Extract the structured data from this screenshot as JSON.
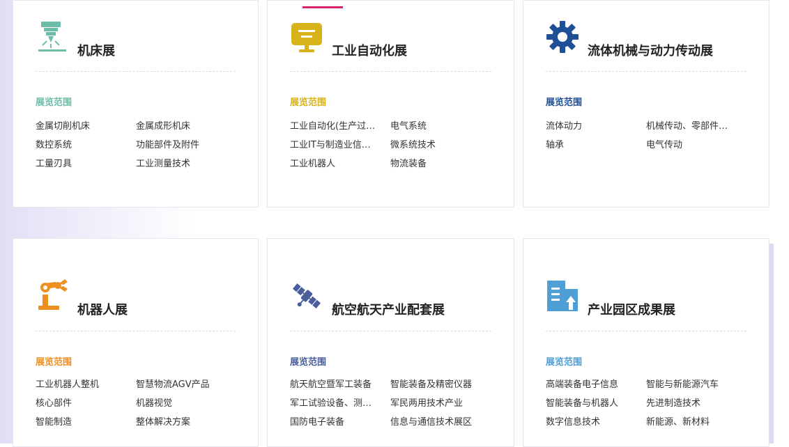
{
  "cards": [
    {
      "title": "机床展",
      "range_label": "展览范围",
      "color": "#6dbba9",
      "icon": "laser-machine-icon",
      "items": [
        "金属切削机床",
        "金属成形机床",
        "数控系统",
        "功能部件及附件",
        "工量刃具",
        "工业测量技术"
      ]
    },
    {
      "title": "工业自动化展",
      "range_label": "展览范围",
      "color": "#d7b319",
      "icon": "monitor-icon",
      "items": [
        "工业自动化(生产过程自动化)",
        "电气系统",
        "工业IT与制造业信息化",
        "微系统技术",
        "工业机器人",
        "物流装备"
      ]
    },
    {
      "title": "流体机械与动力传动展",
      "range_label": "展览范围",
      "color": "#1f4f96",
      "icon": "gear-icon",
      "items": [
        "流体动力",
        "机械传动、零部件及其他",
        "轴承",
        "电气传动"
      ]
    },
    {
      "title": "机器人展",
      "range_label": "展览范围",
      "color": "#ef8f22",
      "icon": "robot-arm-icon",
      "items": [
        "工业机器人整机",
        "智慧物流AGV产品",
        "核心部件",
        "机器视觉",
        "智能制造",
        "整体解决方案"
      ]
    },
    {
      "title": "航空航天产业配套展",
      "range_label": "展览范围",
      "color": "#4a5e9c",
      "icon": "satellite-icon",
      "items": [
        "航天航空暨军工装备",
        "智能装备及精密仪器",
        "军工试验设备、测试仪器",
        "军民两用技术产业",
        "国防电子装备",
        "信息与通信技术展区"
      ]
    },
    {
      "title": "产业园区成果展",
      "range_label": "展览范围",
      "color": "#4e9fd6",
      "icon": "building-tree-icon",
      "items": [
        "高端装备电子信息",
        "智能与新能源汽车",
        "智能装备与机器人",
        "先进制造技术",
        "数字信息技术",
        "新能源、新材料"
      ]
    }
  ]
}
